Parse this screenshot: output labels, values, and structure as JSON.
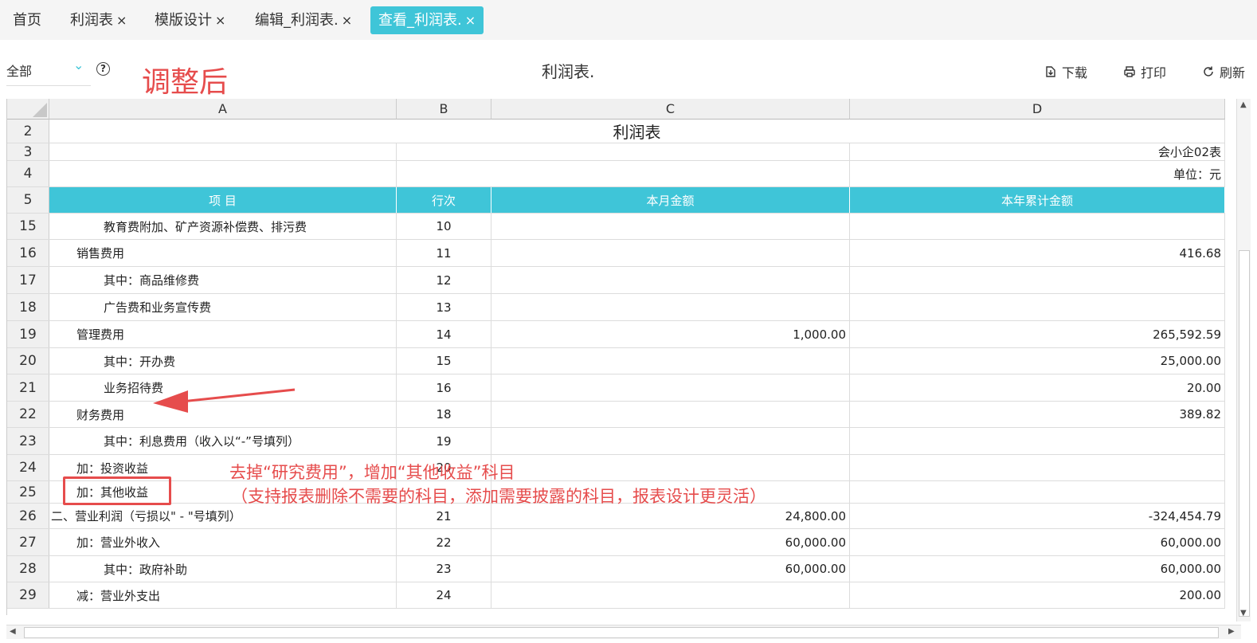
{
  "tabs": [
    {
      "label": "首页",
      "closable": false,
      "active": false
    },
    {
      "label": "利润表",
      "closable": true,
      "active": false
    },
    {
      "label": "模版设计",
      "closable": true,
      "active": false
    },
    {
      "label": "编辑_利润表.",
      "closable": true,
      "active": false
    },
    {
      "label": "查看_利润表.",
      "closable": true,
      "active": true
    }
  ],
  "close_glyph": "×",
  "toolbar": {
    "scope_value": "全部",
    "annotation_title": "调整后",
    "report_title": "利润表.",
    "download_label": "下载",
    "print_label": "打印",
    "refresh_label": "刷新"
  },
  "columns": [
    "A",
    "B",
    "C",
    "D"
  ],
  "sheet": {
    "title_row": {
      "num": "2",
      "text": "利润表"
    },
    "code_row": {
      "num": "3",
      "text": "会小企02表"
    },
    "unit_row": {
      "num": "4",
      "text": "单位：元"
    },
    "header_row": {
      "num": "5",
      "item": "项 目",
      "line": "行次",
      "month": "本月金额",
      "year": "本年累计金额"
    },
    "rows": [
      {
        "num": "15",
        "item": "教育费附加、矿产资源补偿费、排污费",
        "indent": 2,
        "line": "10",
        "month": "",
        "year": ""
      },
      {
        "num": "16",
        "item": "销售费用",
        "indent": 1,
        "line": "11",
        "month": "",
        "year": "416.68"
      },
      {
        "num": "17",
        "item": "其中：商品维修费",
        "indent": 2,
        "line": "12",
        "month": "",
        "year": ""
      },
      {
        "num": "18",
        "item": "广告费和业务宣传费",
        "indent": 2,
        "line": "13",
        "month": "",
        "year": ""
      },
      {
        "num": "19",
        "item": "管理费用",
        "indent": 1,
        "line": "14",
        "month": "1,000.00",
        "year": "265,592.59"
      },
      {
        "num": "20",
        "item": "其中：开办费",
        "indent": 2,
        "line": "15",
        "month": "",
        "year": "25,000.00"
      },
      {
        "num": "21",
        "item": "业务招待费",
        "indent": 2,
        "line": "16",
        "month": "",
        "year": "20.00"
      },
      {
        "num": "22",
        "item": "财务费用",
        "indent": 1,
        "line": "18",
        "month": "",
        "year": "389.82"
      },
      {
        "num": "23",
        "item": "其中：利息费用（收入以“-”号填列）",
        "indent": 2,
        "line": "19",
        "month": "",
        "year": ""
      },
      {
        "num": "24",
        "item": "加：投资收益",
        "indent": 1,
        "line": "20",
        "month": "",
        "year": ""
      },
      {
        "num": "25",
        "item": "加：其他收益",
        "indent": 1,
        "line": "",
        "month": "",
        "year": ""
      },
      {
        "num": "26",
        "item": "二、营业利润（亏损以\" - \"号填列）",
        "indent": 0,
        "line": "21",
        "month": "24,800.00",
        "year": "-324,454.79"
      },
      {
        "num": "27",
        "item": "加：营业外收入",
        "indent": 1,
        "line": "22",
        "month": "60,000.00",
        "year": "60,000.00"
      },
      {
        "num": "28",
        "item": "其中：政府补助",
        "indent": 2,
        "line": "23",
        "month": "60,000.00",
        "year": "60,000.00"
      },
      {
        "num": "29",
        "item": "减：营业外支出",
        "indent": 1,
        "line": "24",
        "month": "",
        "year": "200.00"
      }
    ]
  },
  "annotations": {
    "line1": "去掉“研究费用”，增加“其他收益”科目",
    "line2": "（支持报表删除不需要的科目，添加需要披露的科目，报表设计更灵活）"
  },
  "colors": {
    "accent": "#3fc5d8",
    "annotation": "#e64c4c"
  }
}
